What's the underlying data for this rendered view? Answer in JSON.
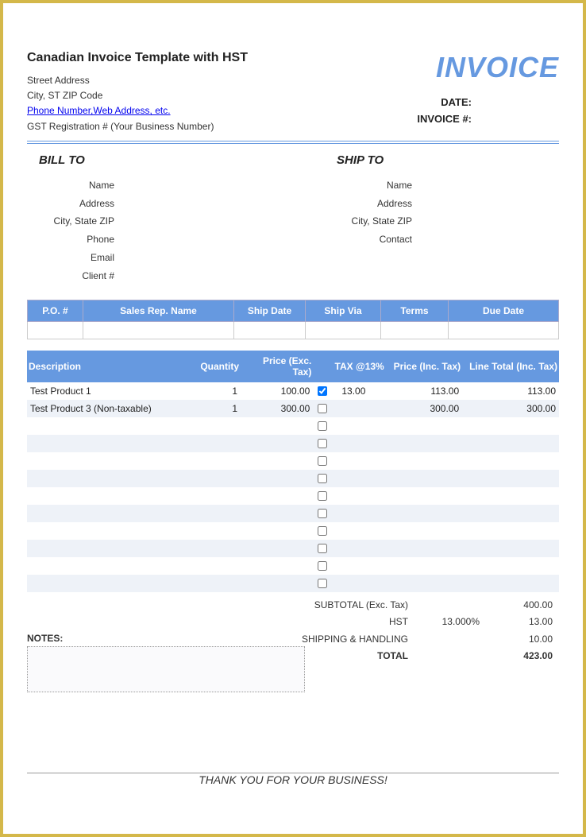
{
  "header": {
    "title": "Canadian Invoice Template with HST",
    "street": "Street Address",
    "city_line": "City, ST  ZIP Code",
    "contact_link": "Phone Number,Web Address, etc.",
    "gst_line": "GST Registration # (Your Business Number)",
    "invoice_word": "INVOICE",
    "date_label": "DATE:",
    "invoice_num_label": "INVOICE #:"
  },
  "bill_to": {
    "title": "BILL TO",
    "rows": [
      "Name",
      "Address",
      "City, State ZIP",
      "Phone",
      "Email",
      "Client #"
    ]
  },
  "ship_to": {
    "title": "SHIP TO",
    "rows": [
      "Name",
      "Address",
      "City, State ZIP",
      "Contact"
    ]
  },
  "po_headers": [
    "P.O. #",
    "Sales Rep. Name",
    "Ship Date",
    "Ship Via",
    "Terms",
    "Due Date"
  ],
  "item_headers": [
    "Description",
    "Quantity",
    "Price (Exc. Tax)",
    "TAX @13%",
    "Price (Inc. Tax)",
    "Line Total (Inc. Tax)"
  ],
  "items": [
    {
      "desc": "Test Product 1",
      "qty": "1",
      "price": "100.00",
      "taxed": true,
      "tax": "13.00",
      "pit": "113.00",
      "lt": "113.00"
    },
    {
      "desc": "Test Product 3 (Non-taxable)",
      "qty": "1",
      "price": "300.00",
      "taxed": false,
      "tax": "",
      "pit": "300.00",
      "lt": "300.00"
    },
    {
      "desc": "",
      "qty": "",
      "price": "",
      "taxed": false,
      "tax": "",
      "pit": "",
      "lt": ""
    },
    {
      "desc": "",
      "qty": "",
      "price": "",
      "taxed": false,
      "tax": "",
      "pit": "",
      "lt": ""
    },
    {
      "desc": "",
      "qty": "",
      "price": "",
      "taxed": false,
      "tax": "",
      "pit": "",
      "lt": ""
    },
    {
      "desc": "",
      "qty": "",
      "price": "",
      "taxed": false,
      "tax": "",
      "pit": "",
      "lt": ""
    },
    {
      "desc": "",
      "qty": "",
      "price": "",
      "taxed": false,
      "tax": "",
      "pit": "",
      "lt": ""
    },
    {
      "desc": "",
      "qty": "",
      "price": "",
      "taxed": false,
      "tax": "",
      "pit": "",
      "lt": ""
    },
    {
      "desc": "",
      "qty": "",
      "price": "",
      "taxed": false,
      "tax": "",
      "pit": "",
      "lt": ""
    },
    {
      "desc": "",
      "qty": "",
      "price": "",
      "taxed": false,
      "tax": "",
      "pit": "",
      "lt": ""
    },
    {
      "desc": "",
      "qty": "",
      "price": "",
      "taxed": false,
      "tax": "",
      "pit": "",
      "lt": ""
    },
    {
      "desc": "",
      "qty": "",
      "price": "",
      "taxed": false,
      "tax": "",
      "pit": "",
      "lt": ""
    }
  ],
  "totals": {
    "subtotal_label": "SUBTOTAL (Exc. Tax)",
    "subtotal": "400.00",
    "hst_label": "HST",
    "hst_rate": "13.000%",
    "hst": "13.00",
    "ship_label": "SHIPPING & HANDLING",
    "ship": "10.00",
    "total_label": "TOTAL",
    "total": "423.00"
  },
  "notes_label": "NOTES:",
  "thanks": "THANK YOU FOR YOUR BUSINESS!"
}
